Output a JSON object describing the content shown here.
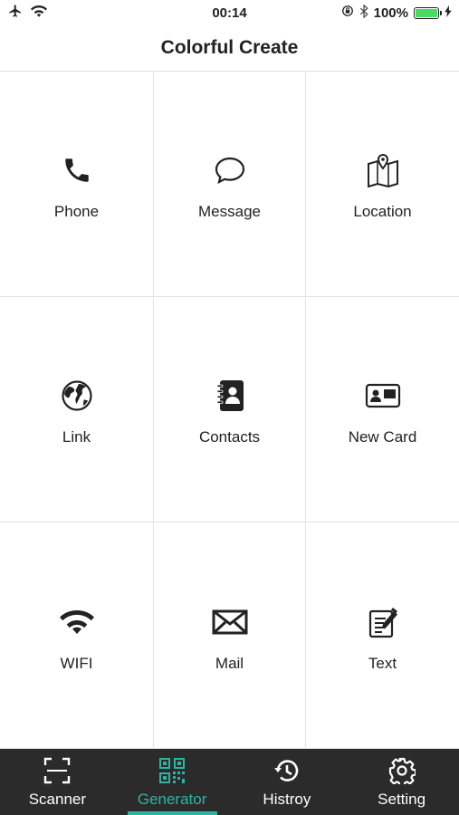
{
  "status_bar": {
    "time": "00:14",
    "battery_percent": "100%",
    "battery_level": 1.0,
    "battery_color": "#4cd964"
  },
  "header": {
    "title": "Colorful Create"
  },
  "grid": [
    {
      "label": "Phone",
      "icon": "phone-icon"
    },
    {
      "label": "Message",
      "icon": "message-icon"
    },
    {
      "label": "Location",
      "icon": "map-icon"
    },
    {
      "label": "Link",
      "icon": "globe-icon"
    },
    {
      "label": "Contacts",
      "icon": "contacts-book-icon"
    },
    {
      "label": "New Card",
      "icon": "id-card-icon"
    },
    {
      "label": "WIFI",
      "icon": "wifi-icon"
    },
    {
      "label": "Mail",
      "icon": "mail-icon"
    },
    {
      "label": "Text",
      "icon": "note-icon"
    }
  ],
  "tabs": [
    {
      "label": "Scanner",
      "icon": "scan-icon",
      "active": false
    },
    {
      "label": "Generator",
      "icon": "qr-code-icon",
      "active": true
    },
    {
      "label": "Histroy",
      "icon": "history-icon",
      "active": false
    },
    {
      "label": "Setting",
      "icon": "gear-icon",
      "active": false
    }
  ],
  "colors": {
    "accent": "#2db4a3",
    "tab_bar_bg": "#2b2b2b"
  }
}
